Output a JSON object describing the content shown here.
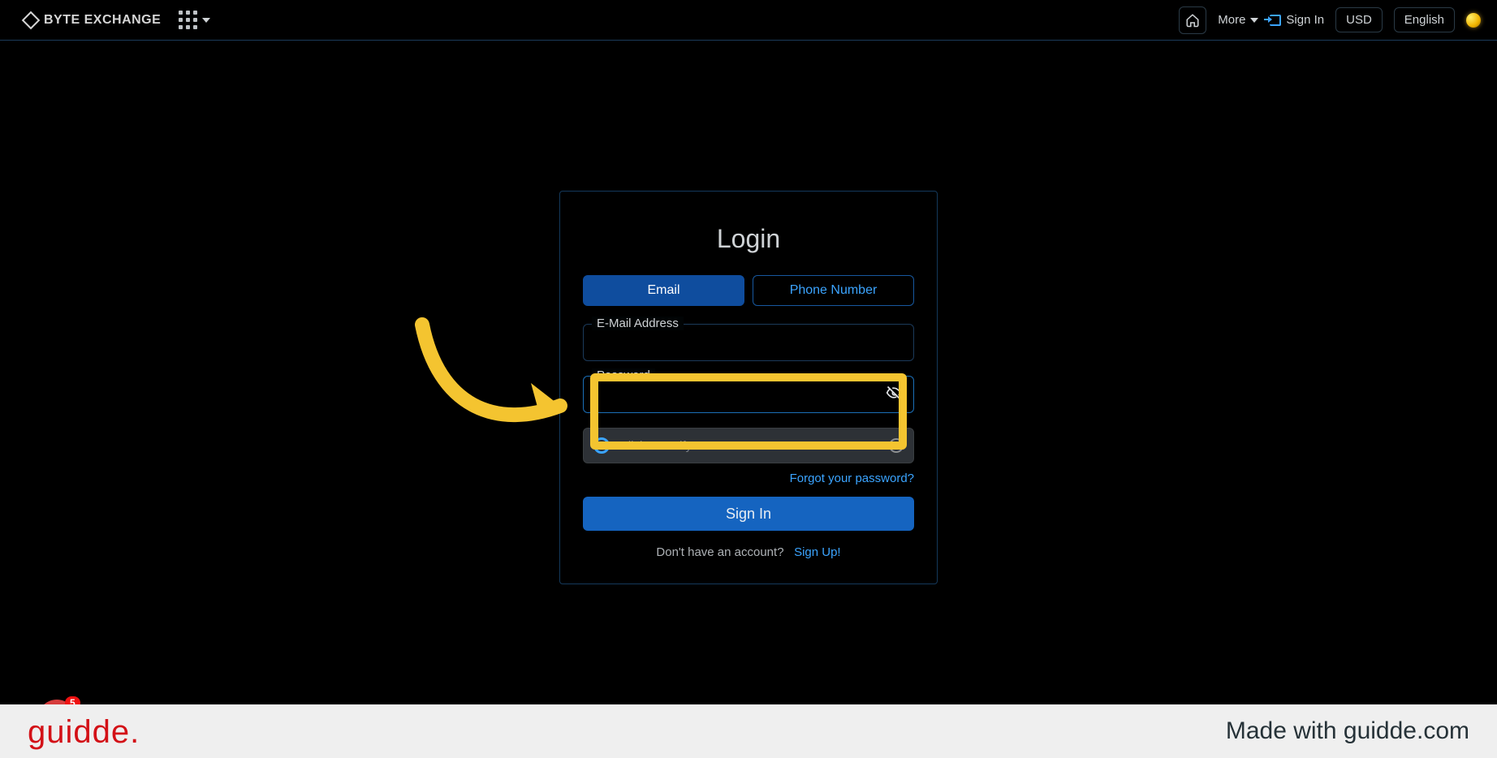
{
  "header": {
    "brand": "BYTE EXCHANGE",
    "more": "More",
    "signin": "Sign In",
    "currency": "USD",
    "language": "English"
  },
  "login": {
    "title": "Login",
    "tabs": {
      "email": "Email",
      "phone": "Phone Number"
    },
    "email_label": "E-Mail Address",
    "password_label": "Password",
    "password_value": "",
    "captcha": "Click to verify",
    "forgot": "Forgot your password?",
    "submit": "Sign In",
    "no_account": "Don't have an account?",
    "signup": "Sign Up!"
  },
  "chat": {
    "unread": "5"
  },
  "footer": {
    "brand": "guidde",
    "made": "Made with guidde.com"
  }
}
